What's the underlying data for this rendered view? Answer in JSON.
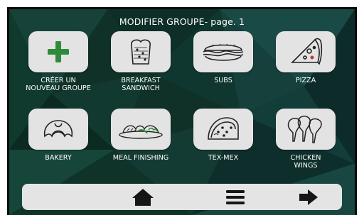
{
  "header": {
    "title": "MODIFIER GROUPE- page. 1"
  },
  "groups": [
    {
      "label": "CRÉER UN\nNOUVEAU GROUPE",
      "icon": "plus-icon"
    },
    {
      "label": "BREAKFAST\nSANDWICH",
      "icon": "toast-icon"
    },
    {
      "label": "SUBS",
      "icon": "sub-sandwich-icon"
    },
    {
      "label": "PIZZA",
      "icon": "pizza-slice-icon"
    },
    {
      "label": "BAKERY",
      "icon": "croissant-icon"
    },
    {
      "label": "MEAL FINISHING",
      "icon": "meal-plate-icon"
    },
    {
      "label": "TEX-MEX",
      "icon": "taco-icon"
    },
    {
      "label": "CHICKEN\nWINGS",
      "icon": "chicken-wings-icon"
    }
  ],
  "navbar": {
    "home": "home-icon",
    "menu": "menu-icon",
    "next": "arrow-right-icon"
  },
  "colors": {
    "plus": "#2e8b3c",
    "icon_stroke": "#222222",
    "tile_bg": "#e3e3e3",
    "background": "#103127"
  }
}
